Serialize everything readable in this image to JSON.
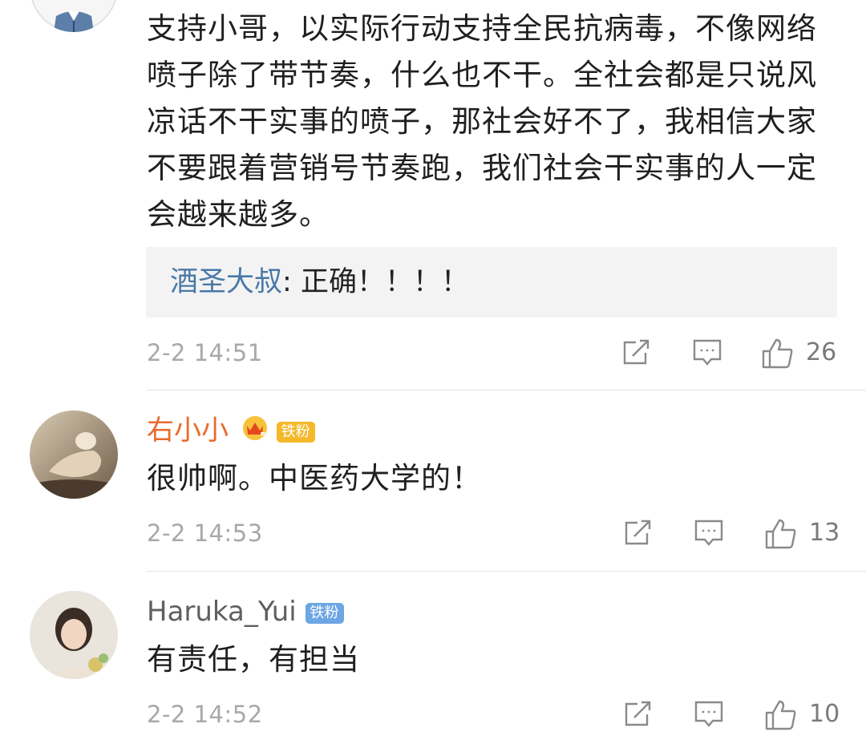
{
  "comments": [
    {
      "username": "",
      "text": "支持小哥，以实际行动支持全民抗病毒，不像网络喷子除了带节奏，什么也不干。全社会都是只说风凉话不干实事的喷子，那社会好不了，我相信大家不要跟着营销号节奏跑，我们社会干实事的人一定会越来越多。",
      "reply": {
        "user": "酒圣大叔",
        "separator": ": ",
        "text": "正确！！！！"
      },
      "timestamp": "2-2 14:51",
      "like_count": "26"
    },
    {
      "username": "右小小",
      "badge_level": "5",
      "fan_badge": "铁粉",
      "text": "很帅啊。中医药大学的！",
      "timestamp": "2-2 14:53",
      "like_count": "13"
    },
    {
      "username": "Haruka_Yui",
      "fan_badge": "铁粉",
      "text": "有责任，有担当",
      "timestamp": "2-2 14:52",
      "like_count": "10"
    }
  ],
  "icons": {
    "share": "share-icon",
    "comment": "comment-icon",
    "like": "like-icon"
  },
  "colors": {
    "reply_user": "#4a78a8",
    "vip_username": "#e96a2b",
    "timestamp": "#a8a8a8",
    "reply_background": "#f3f3f3",
    "fan_badge_gold": "#f4b82a",
    "fan_badge_blue": "#6ca6e4"
  }
}
